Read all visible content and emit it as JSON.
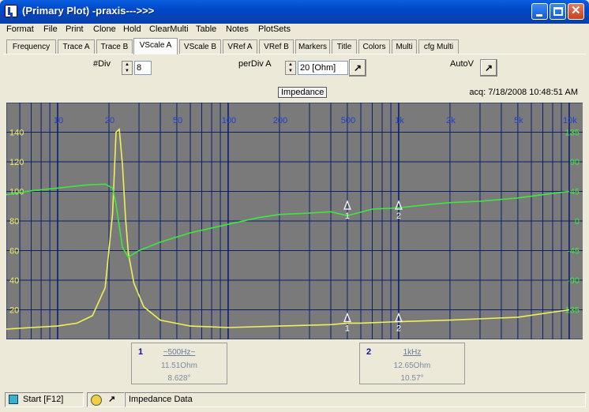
{
  "window": {
    "title": "(Primary Plot) -praxis--->>>"
  },
  "menu": [
    "Format",
    "File",
    "Print",
    "Clone",
    "Hold",
    "ClearMulti",
    "Table",
    "Notes",
    "PlotSets"
  ],
  "tabs": [
    "Frequency",
    "Trace A",
    "Trace B",
    "VScale A",
    "VScale B",
    "VRef A",
    "VRef B",
    "Markers",
    "Title",
    "Colors",
    "Multi",
    "cfg Multi"
  ],
  "active_tab": "VScale A",
  "controls": {
    "div_label": "#Div",
    "div_value": "8",
    "perdiv_label": "perDiv A",
    "perdiv_value": "20 [Ohm]",
    "autov_label": "AutoV"
  },
  "plot": {
    "label": "Impedance",
    "acq": "acq: 7/18/2008 10:48:51 AM",
    "x_ticks": [
      "10",
      "20",
      "50",
      "100",
      "200",
      "500",
      "1k",
      "2k",
      "5k",
      "10k"
    ],
    "y_left_ticks": [
      "140",
      "120",
      "100",
      "80",
      "60",
      "40",
      "20"
    ],
    "y_right_ticks": [
      "135",
      "90",
      "45",
      "0",
      "-45",
      "-90",
      "-135"
    ],
    "right_zero_label": "0",
    "right_small_label": "Ch1",
    "marker1_label": "1",
    "marker2_label": "2"
  },
  "markers": [
    {
      "num": "1",
      "freq": "~500Hz~",
      "magnitude": "11.51Ohm",
      "phase": "8.628°"
    },
    {
      "num": "2",
      "freq": "1kHz",
      "magnitude": "12.65Ohm",
      "phase": "10.57°"
    }
  ],
  "status": {
    "start": "Start [F12]",
    "text": "Impedance Data"
  },
  "colors": {
    "plot_bg": "#7a7a7a",
    "grid": "#0b1f6b",
    "magnitude": "#f0f05a",
    "phase": "#3ee83e",
    "tick_text": "#1f3fd0"
  },
  "chart_data": {
    "type": "line",
    "x_scale": "log",
    "xlim": [
      5,
      12000
    ],
    "ylim": [
      0,
      160
    ],
    "y2lim": [
      -180,
      180
    ],
    "series": [
      {
        "axis": "left",
        "color": "#f0f05a",
        "x": [
          5,
          7,
          10,
          13,
          16,
          19,
          21,
          22,
          23,
          24,
          25,
          26,
          28,
          32,
          40,
          60,
          100,
          200,
          400,
          500,
          600,
          1000,
          2000,
          5000,
          10000
        ],
        "values": [
          7,
          8,
          9,
          11,
          16,
          35,
          85,
          140,
          142,
          118,
          82,
          58,
          38,
          22,
          13,
          9,
          8,
          9,
          10,
          11,
          11,
          12,
          13,
          15,
          20
        ]
      },
      {
        "axis": "right",
        "color": "#3ee83e",
        "x": [
          5,
          7,
          10,
          15,
          19,
          21,
          22,
          24,
          26,
          30,
          40,
          60,
          100,
          150,
          200,
          300,
          400,
          500,
          700,
          1000,
          1500,
          2000,
          3000,
          5000,
          7000,
          10000
        ],
        "values": [
          40,
          46,
          50,
          55,
          56,
          50,
          25,
          -40,
          -55,
          -45,
          -32,
          -18,
          -5,
          5,
          10,
          12,
          14,
          8,
          18,
          20,
          25,
          28,
          30,
          35,
          40,
          45
        ]
      }
    ]
  }
}
